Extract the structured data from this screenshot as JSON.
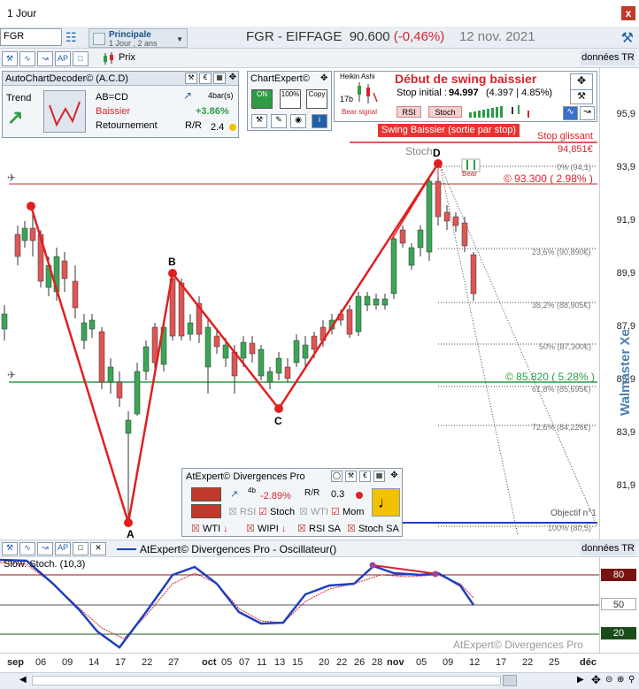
{
  "window": {
    "title": "1 Jour",
    "close": "x"
  },
  "infobar": {
    "symbol": "FGR",
    "principale": "Principale",
    "period": "1 Jour , 2 ans",
    "stock_name": "FGR - EIFFAGE",
    "price": "90.600",
    "change": "(-0,46%)",
    "date": "12 nov. 2021"
  },
  "toolbar": {
    "prix_label": "Prix",
    "donnees": "données TR"
  },
  "acd": {
    "title": "AutoChartDecoder© (A.C.D)",
    "trend_label": "Trend",
    "pattern": "AB=CD",
    "direction": "Baissier",
    "type": "Retournement",
    "bars": "4bar(s)",
    "pct": "+3.86%",
    "rr": "2.4"
  },
  "chartexpert": {
    "title": "ChartExpert©",
    "on": "ON",
    "pct100": "100%",
    "copy": "Copy"
  },
  "signal": {
    "icon_title": "Heikin Ashi",
    "bars": "17b",
    "bear_signal": "Bear signal",
    "title": "Début de swing baissier",
    "stop_label": "Stop initial :",
    "stop_value": "94.997",
    "stop_detail": "(4.397 | 4.85%)",
    "rsi": "RSI",
    "stoch": "Stoch",
    "swing": "Swing Baissier (sortie par stop)"
  },
  "chart": {
    "stop_glissant": "Stop glissant",
    "stop_price": "94,851€",
    "level_top": "© 93.300 ( 2.98% )",
    "level_bottom": "© 85.820 ( 5.28% )",
    "stoch_label": "Stoch",
    "bear_label": "Bear",
    "fib_0": "0% (94,1)",
    "fib_236": "23,6% (90,890€)",
    "fib_382": "38,2% (88,905€)",
    "fib_50": "50% (87,300€)",
    "fib_618": "61,8% (85,695€)",
    "fib_726": "72,6% (84,226€)",
    "fib_100": "100% (80,5)",
    "objectif": "Objectif n°1",
    "points": {
      "a": "A",
      "b": "B",
      "c": "C",
      "d": "D"
    },
    "price_labels": [
      "95,9",
      "93,9",
      "91,9",
      "89,9",
      "87,9",
      "85,9",
      "83,9",
      "81,9"
    ],
    "watermark": "Walmaster Xe"
  },
  "divergences": {
    "title": "AtExpert© Divergences Pro",
    "pct": "-2.89%",
    "val": "0.3",
    "rsi": "RSI",
    "stoch": "Stoch",
    "wti": "WTI",
    "mom": "Mom",
    "wti_dn": "WTI",
    "wipi_dn": "WIPI",
    "rsi_sa": "RSI SA",
    "stoch_sa": "Stoch SA",
    "bars": "4b"
  },
  "oscillator": {
    "bar_title": "AtExpert© Divergences Pro - Oscillateur()",
    "label": "Slow. Stoch. (10,3)",
    "levels": [
      "80",
      "50",
      "20"
    ],
    "watermark": "AtExpert© Divergences Pro"
  },
  "dates": [
    "sep",
    "06",
    "09",
    "14",
    "17",
    "22",
    "27",
    "oct",
    "05",
    "07",
    "11",
    "13",
    "15",
    "20",
    "22",
    "26",
    "28",
    "nov",
    "05",
    "09",
    "12",
    "17",
    "22",
    "25",
    "déc"
  ],
  "colors": {
    "red": "#d6242a",
    "green": "#2e9b45",
    "blue": "#1f3fbf",
    "accent": "#1f5fa8"
  }
}
